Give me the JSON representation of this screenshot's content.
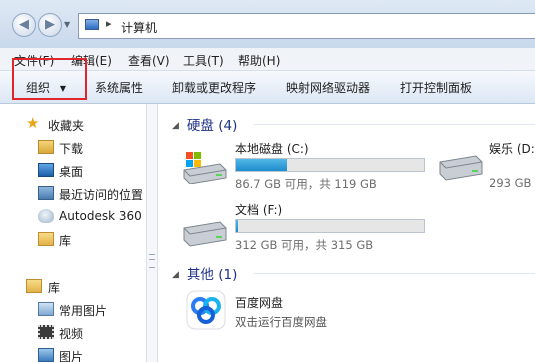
{
  "address": {
    "crumb": "计算机",
    "separator": "▸"
  },
  "menu": [
    "文件(F)",
    "编辑(E)",
    "查看(V)",
    "工具(T)",
    "帮助(H)"
  ],
  "toolbar": {
    "organize": "组织",
    "organize_arrow": "▼",
    "items": [
      "系统属性",
      "卸载或更改程序",
      "映射网络驱动器",
      "打开控制面板"
    ]
  },
  "nav": {
    "favorites": {
      "label": "收藏夹",
      "icon": "star-icon"
    },
    "favorites_items": [
      {
        "label": "下载",
        "icon": "download-folder-icon"
      },
      {
        "label": "桌面",
        "icon": "desktop-icon"
      },
      {
        "label": "最近访问的位置",
        "icon": "recent-places-icon"
      },
      {
        "label": "Autodesk 360",
        "icon": "cloud-icon"
      },
      {
        "label": "库",
        "icon": "library-folder-icon"
      }
    ],
    "libraries": {
      "label": "库",
      "icon": "library-icon"
    },
    "library_items": [
      {
        "label": "常用图片",
        "icon": "pictures-icon"
      },
      {
        "label": "视频",
        "icon": "video-icon"
      },
      {
        "label": "图片",
        "icon": "image-icon"
      }
    ]
  },
  "groups": {
    "hard_disks": {
      "label": "硬盘 (4)"
    },
    "other": {
      "label": "其他 (1)"
    }
  },
  "drives": [
    {
      "name": "本地磁盘 (C:)",
      "free": "86.7 GB 可用，共 119 GB",
      "used_fraction": 0.27,
      "icon": "windows-drive-icon"
    },
    {
      "name": "娱乐 (D:",
      "free": "293 GB",
      "used_fraction": null,
      "icon": "drive-icon"
    },
    {
      "name": "文档 (F:)",
      "free": "312 GB 可用，共 315 GB",
      "used_fraction": 0.01,
      "icon": "drive-icon"
    }
  ],
  "other_items": [
    {
      "name": "百度网盘",
      "desc": "双击运行百度网盘",
      "icon": "baidu-netdisk-icon"
    }
  ],
  "colors": {
    "accent": "#1e3287",
    "highlight": "#e0262b",
    "bar_fill": "#1d8ccc"
  }
}
